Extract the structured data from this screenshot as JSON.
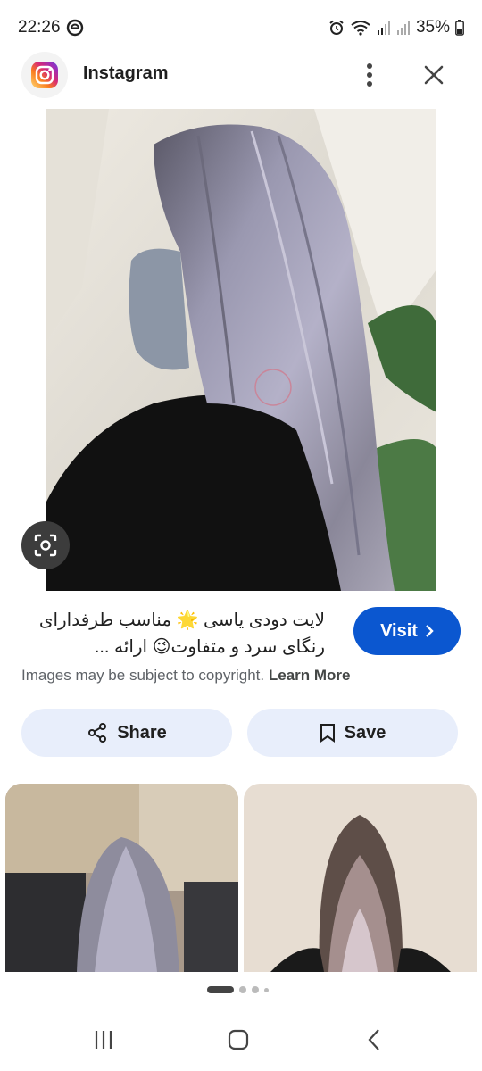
{
  "status_bar": {
    "time": "22:26",
    "battery": "35%",
    "icons": [
      "alarm-icon",
      "wifi-icon",
      "signal-icon",
      "signal-icon",
      "battery-icon"
    ]
  },
  "header": {
    "app_name": "Instagram",
    "icons": [
      "instagram-logo",
      "more-vert-icon",
      "close-icon"
    ]
  },
  "result": {
    "caption": "لایت دودی یاسی 🌟 مناسب طرفدارای رنگای سرد و متفاوت😉 ارائه ...",
    "visit_label": "Visit",
    "copyright_text": "Images may be subject to copyright.",
    "learn_more_label": "Learn More",
    "share_label": "Share",
    "save_label": "Save"
  },
  "colors": {
    "visit_bg": "#0b57d0",
    "action_bg": "#e8eefb",
    "lens_bg": "#3c3c3c"
  },
  "pagination": {
    "active_index": 0,
    "count": 4
  },
  "nav_bar": {
    "icons": [
      "recent-apps-icon",
      "home-icon",
      "back-icon"
    ]
  }
}
